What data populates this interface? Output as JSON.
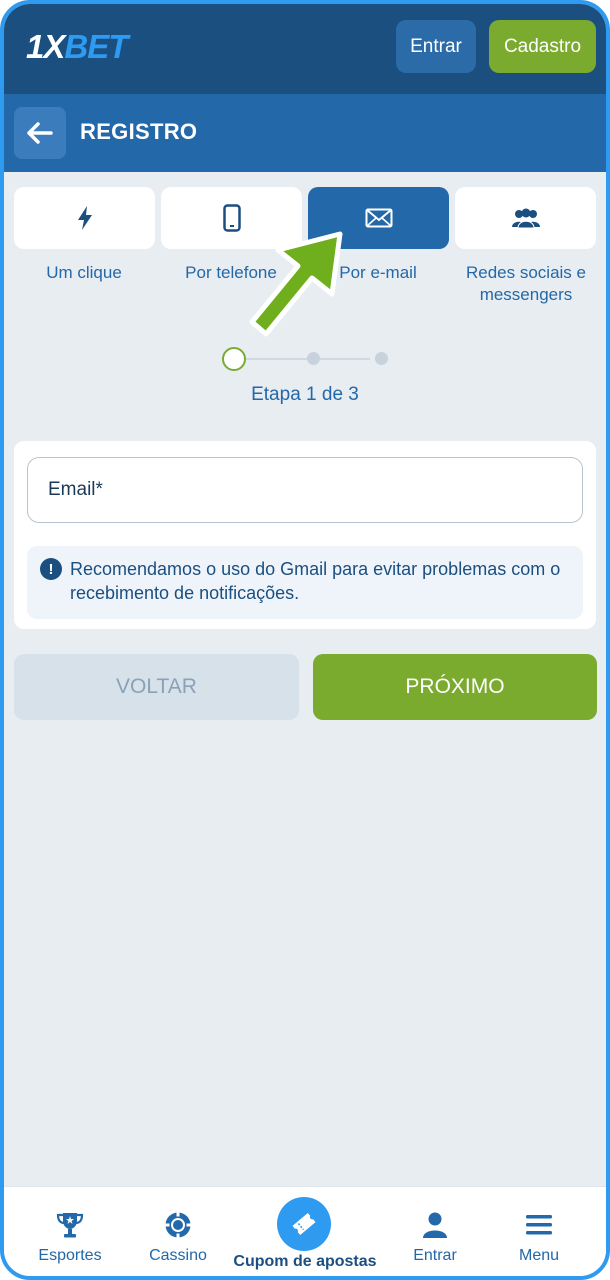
{
  "header": {
    "logo_prefix": "1X",
    "logo_suffix": "BET",
    "login_label": "Entrar",
    "register_label": "Cadastro"
  },
  "subheader": {
    "title": "REGISTRO"
  },
  "tabs": [
    {
      "label": "Um clique",
      "icon": "lightning-icon",
      "active": false
    },
    {
      "label": "Por telefone",
      "icon": "phone-icon",
      "active": false
    },
    {
      "label": "Por e-mail",
      "icon": "envelope-icon",
      "active": true
    },
    {
      "label": "Redes sociais e messengers",
      "icon": "users-icon",
      "active": false
    }
  ],
  "stepper": {
    "text": "Etapa 1 de 3",
    "current": 1,
    "total": 3
  },
  "form": {
    "email_placeholder": "Email*",
    "info_text": "Recomendamos o uso do Gmail para evitar problemas com o recebimento de notificações."
  },
  "actions": {
    "back_label": "VOLTAR",
    "next_label": "PRÓXIMO"
  },
  "bottom_nav": {
    "items": [
      {
        "label": "Esportes",
        "icon": "trophy-icon"
      },
      {
        "label": "Cassino",
        "icon": "casino-chip-icon"
      },
      {
        "label": "Cupom de apostas",
        "icon": "ticket-icon"
      },
      {
        "label": "Entrar",
        "icon": "user-icon"
      },
      {
        "label": "Menu",
        "icon": "hamburger-icon"
      }
    ]
  },
  "colors": {
    "header": "#1b4f80",
    "subheader": "#2368a8",
    "accent_green": "#7aab2e",
    "accent_blue": "#2e9bf0"
  }
}
